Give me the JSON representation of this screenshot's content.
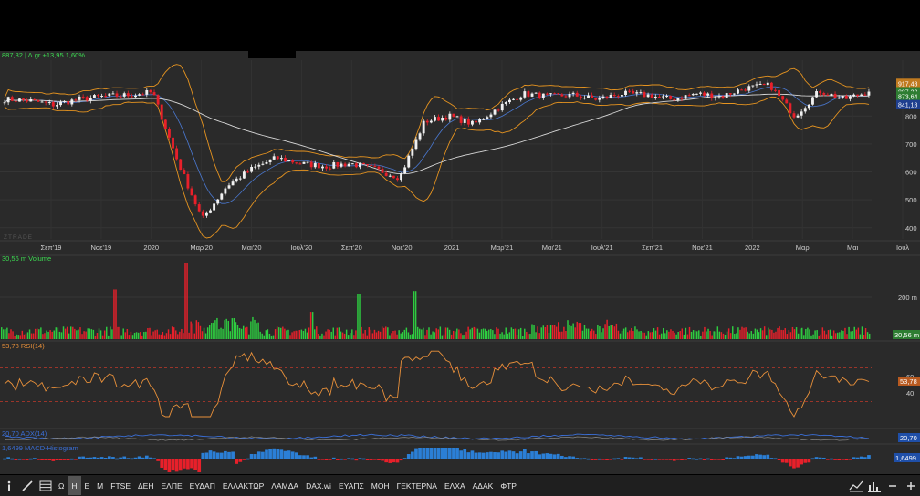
{
  "colors": {
    "up": "#2ecc40",
    "down": "#e8202a",
    "bb": "#e69420",
    "ma_long": "#d8d8d8",
    "rsi": "#e8903a",
    "macd_pos": "#2b7fd6",
    "macd_neg": "#e8202a",
    "price_tag": "#2e7d32",
    "volume_tag": "#2e7d32",
    "rsi_tag": "#b85a20",
    "adx_tag": "#1f4fa8",
    "macd_tag": "#1f4fa8"
  },
  "price_panel": {
    "legend": "887,32 | Δ.gr +13,95 1,60%",
    "watermark": "ZTRADE",
    "tags": [
      {
        "value": 917.48,
        "label": "917,48",
        "color": "#c07a20"
      },
      {
        "value": 887.32,
        "label": "887,32",
        "color": "#2e7d32"
      },
      {
        "value": 871.5,
        "label": "873,64",
        "color": "#2e7d32"
      },
      {
        "value": 841.18,
        "label": "841,18",
        "color": "#1f3f8f"
      }
    ]
  },
  "volume_panel": {
    "legend": "30,56 m Volume",
    "tag": "30,56 m"
  },
  "rsi_panel": {
    "legend": "53,78 RSI(14)",
    "tag": "53,78"
  },
  "adx_panel": {
    "legend": "20,70 ADX(14)",
    "tag": "20,70"
  },
  "macd_panel": {
    "legend": "1,6499 MACD-Histogram",
    "tag": "1,6499"
  },
  "chart_data": [
    {
      "type": "candlestick",
      "title": "",
      "x_ticks": [
        "Σεπ'19",
        "Νοε'19",
        "2020",
        "Μαρ'20",
        "Μαι'20",
        "Ιουλ'20",
        "Σεπ'20",
        "Νοε'20",
        "2021",
        "Μαρ'21",
        "Μαι'21",
        "Ιουλ'21",
        "Σεπ'21",
        "Νοε'21",
        "2022",
        "Μαρ",
        "Μαι",
        "Ιουλ"
      ],
      "y_ticks": [
        400,
        500,
        600,
        700,
        800
      ],
      "ylim": [
        360,
        1000
      ],
      "keypoints": [
        {
          "x": "Αυγ'19",
          "close": 860
        },
        {
          "x": "Σεπ'19",
          "close": 855
        },
        {
          "x": "Οκτ'19",
          "close": 840
        },
        {
          "x": "Νοε'19",
          "close": 860
        },
        {
          "x": "Δεκ'19",
          "close": 870
        },
        {
          "x": "Ιαν'20",
          "close": 875
        },
        {
          "x": "Φεβ'20",
          "close": 885
        },
        {
          "x": "Μαρ'20",
          "close": 640
        },
        {
          "x": "Μαρ'20",
          "close": 430
        },
        {
          "x": "Απρ'20",
          "close": 550
        },
        {
          "x": "Μαι'20",
          "close": 610
        },
        {
          "x": "Ιουν'20",
          "close": 650
        },
        {
          "x": "Ιουλ'20",
          "close": 630
        },
        {
          "x": "Αυγ'20",
          "close": 620
        },
        {
          "x": "Σεπ'20",
          "close": 630
        },
        {
          "x": "Οκτ'20",
          "close": 610
        },
        {
          "x": "Νοε'20",
          "close": 580
        },
        {
          "x": "Δεκ'20",
          "close": 780
        },
        {
          "x": "Ιαν'21",
          "close": 800
        },
        {
          "x": "Φεβ'21",
          "close": 770
        },
        {
          "x": "Μαρ'21",
          "close": 830
        },
        {
          "x": "Απρ'21",
          "close": 880
        },
        {
          "x": "Μαι'21",
          "close": 870
        },
        {
          "x": "Ιουν'21",
          "close": 875
        },
        {
          "x": "Ιουλ'21",
          "close": 860
        },
        {
          "x": "Αυγ'21",
          "close": 880
        },
        {
          "x": "Σεπ'21",
          "close": 875
        },
        {
          "x": "Οκτ'21",
          "close": 860
        },
        {
          "x": "Νοε'21",
          "close": 880
        },
        {
          "x": "Δεκ'21",
          "close": 870
        },
        {
          "x": "Ιαν'22",
          "close": 900
        },
        {
          "x": "Φεβ'22",
          "close": 910
        },
        {
          "x": "Μαρ'22",
          "close": 800
        },
        {
          "x": "Απρ'22",
          "close": 890
        },
        {
          "x": "Μαι'22",
          "close": 860
        },
        {
          "x": "Μαι'22",
          "close": 887.32
        }
      ]
    },
    {
      "type": "bar",
      "title": "Volume",
      "y_ticks": [
        "200 m"
      ],
      "last_value": "30,56 m"
    },
    {
      "type": "line",
      "title": "RSI(14)",
      "y_ticks": [
        40,
        60
      ],
      "ylim": [
        0,
        100
      ],
      "bands": [
        30,
        70
      ],
      "last_value": 53.78
    },
    {
      "type": "line",
      "title": "ADX(14)",
      "last_value": 20.7
    },
    {
      "type": "bar",
      "title": "MACD-Histogram",
      "last_value": 1.6499
    }
  ],
  "toolbar": {
    "buttons": [
      "Ω",
      "Η",
      "Ε",
      "Μ",
      "FTSE",
      "ΔΕΗ",
      "ΕΛΠΕ",
      "ΕΥΔΑΠ",
      "ΕΛΛΑΚΤΩΡ",
      "ΛΑΜΔΑ",
      "DAX.wi",
      "ΕΥΑΠΣ",
      "ΜΟΗ",
      "ΓΕΚΤΕΡΝΑ",
      "ΕΛΧΑ",
      "ΑΔΑΚ",
      "ΦΤΡ"
    ],
    "active_index": 1
  }
}
